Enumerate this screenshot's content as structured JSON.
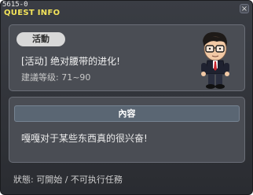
{
  "window": {
    "id": "5615-0",
    "title": "QUEST INFO",
    "close_label": "×"
  },
  "quest": {
    "category": "活動",
    "title": "[活动] 绝对腰带的进化!",
    "level_label": "建議等级: 71~90"
  },
  "content": {
    "header": "內容",
    "text": "嘎嘎对于某些东西真的很兴奋!"
  },
  "status": {
    "text": "狀態: 可開始 / 不可执行任務"
  },
  "npc": {
    "icon": "npc-character-glasses"
  }
}
